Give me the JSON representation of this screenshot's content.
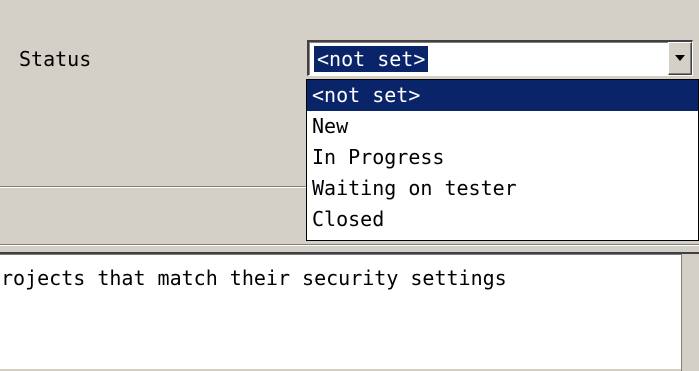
{
  "field": {
    "label": "Status",
    "value": "<not set>",
    "options": [
      "<not set>",
      "New",
      "In Progress",
      "Waiting on tester",
      "Closed"
    ],
    "selected_index": 0
  },
  "description": {
    "text": "rojects that match their security settings"
  },
  "colors": {
    "window_bg": "#d4d0c8",
    "selection_bg": "#0a246a",
    "selection_fg": "#ffffff"
  },
  "icons": {
    "combo_arrow": "chevron-down-icon"
  }
}
